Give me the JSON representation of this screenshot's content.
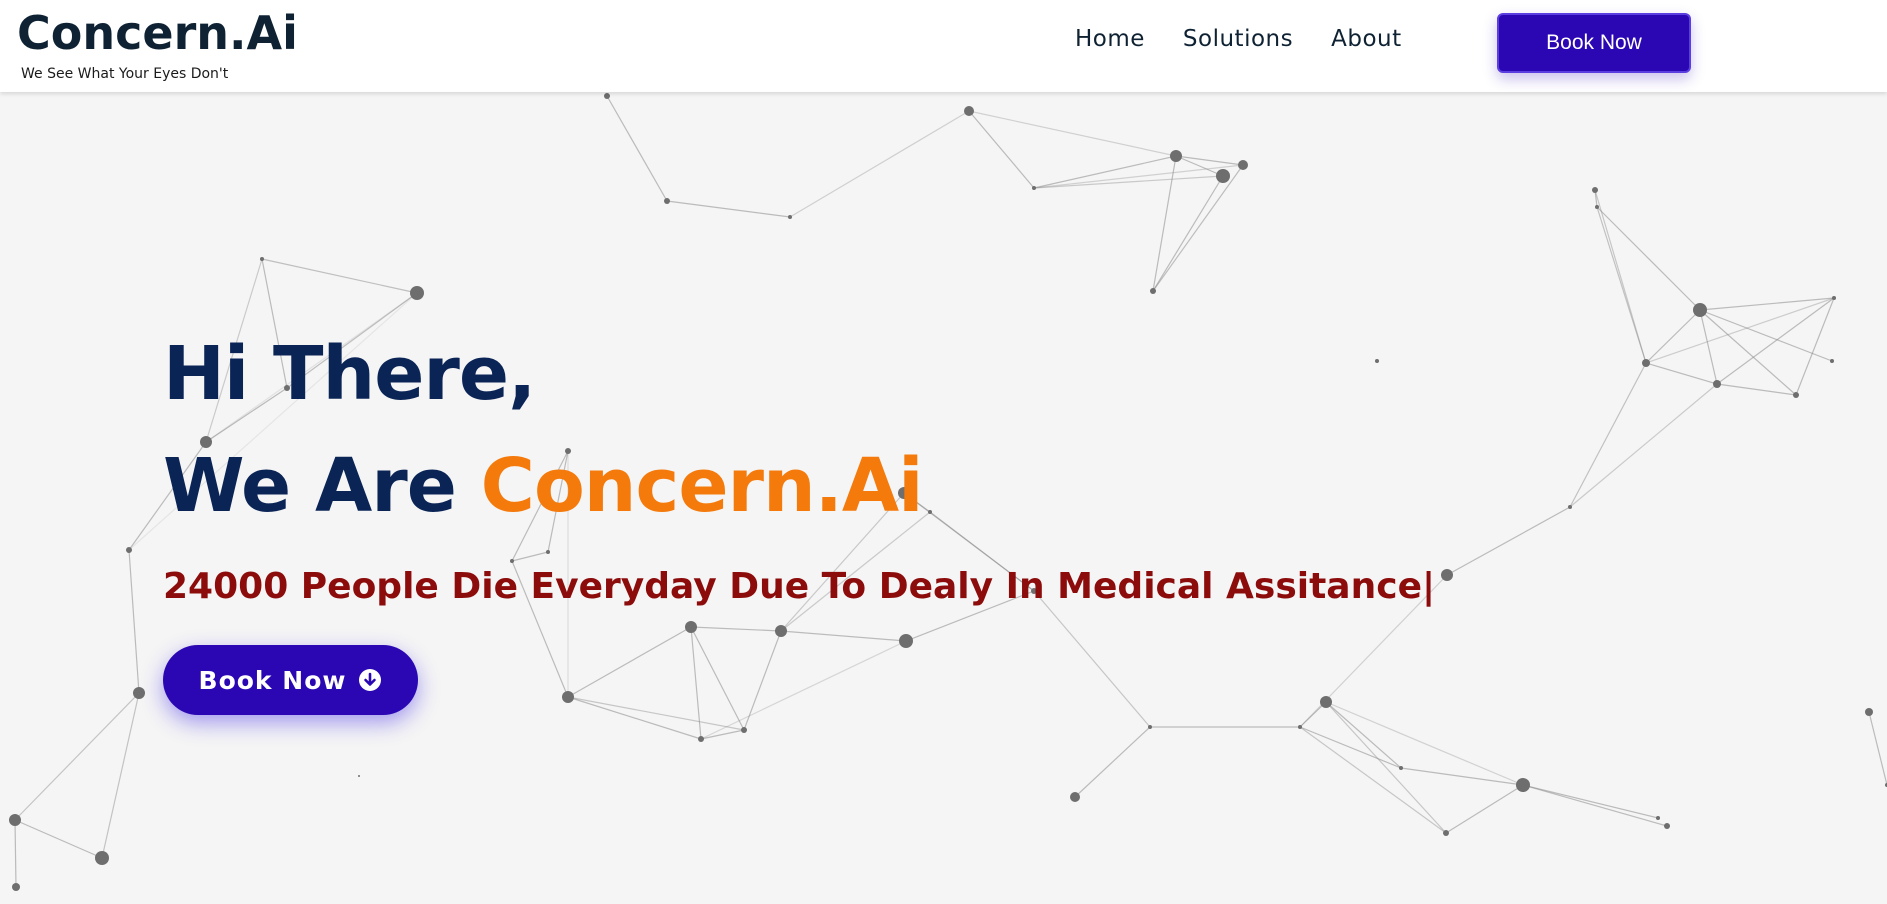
{
  "header": {
    "brand_name": "Concern.Ai",
    "tagline": "We See What Your Eyes Don't",
    "nav": [
      {
        "label": "Home"
      },
      {
        "label": "Solutions"
      },
      {
        "label": "About"
      }
    ],
    "cta_label": "Book Now"
  },
  "hero": {
    "line1": "Hi There,",
    "line2_prefix": "We Are ",
    "line2_accent": "Concern.Ai",
    "subtitle": "24000 People Die Everyday Due To Dealy In Medical Assitance|",
    "cta_label": "Book Now",
    "cta_icon": "arrow-down-circle-icon"
  },
  "colors": {
    "brand_dark": "#0f2233",
    "headline": "#0a2456",
    "accent_orange": "#f57a0c",
    "subtitle_red": "#8c0b0b",
    "button_purple": "#2a07b3",
    "background": "#f5f5f5"
  }
}
